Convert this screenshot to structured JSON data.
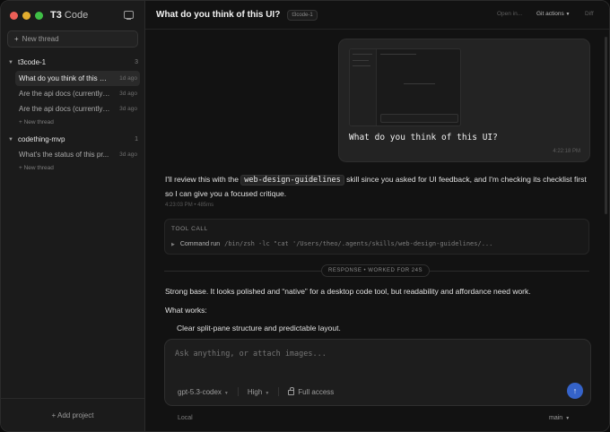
{
  "window": {
    "traffic_lights": [
      "#ec5f57",
      "#e3ad2f",
      "#3fbf46"
    ],
    "app_name_bold": "T3",
    "app_name_rest": " Code"
  },
  "sidebar": {
    "new_thread_label": "New thread",
    "projects": [
      {
        "name": "t3code-1",
        "count": "3",
        "threads": [
          {
            "title": "What do you think of this UI?",
            "ago": "1d ago",
            "active": true
          },
          {
            "title": "Are the api docs (currently ...",
            "ago": "3d ago",
            "active": false
          },
          {
            "title": "Are the api docs (currently ...",
            "ago": "3d ago",
            "active": false
          }
        ],
        "new_thread_link": "+ New thread"
      },
      {
        "name": "codething-mvp",
        "count": "1",
        "threads": [
          {
            "title": "What's the status of this pr...",
            "ago": "3d ago",
            "active": false
          }
        ],
        "new_thread_link": "+ New thread"
      }
    ],
    "add_project": "+ Add project"
  },
  "header": {
    "title": "What do you think of this UI?",
    "repo_badge": "t3code-1",
    "open_in": "Open in...",
    "git_actions": "Git actions",
    "diff": "Diff"
  },
  "conversation": {
    "user_message": {
      "text": "What do you think of this UI?",
      "time": "4:22:18 PM"
    },
    "assistant_intro": {
      "before": "I'll review this with the ",
      "chip": "web-design-guidelines",
      "after": " skill since you asked for UI feedback, and I'm checking its checklist first so I can give you a focused critique.",
      "meta": "4:23:03 PM • 485ms"
    },
    "tool_call": {
      "label": "TOOL CALL",
      "action": "Command run",
      "command": "/bin/zsh -lc \"cat '/Users/theo/.agents/skills/web-design-guidelines/..."
    },
    "divider_label": "RESPONSE • WORKED FOR 24S",
    "response_p1": "Strong base. It looks polished and “native” for a desktop code tool, but readability and affordance need work.",
    "response_p2": "What works:",
    "response_li1": "Clear split-pane structure and predictable layout."
  },
  "composer": {
    "placeholder": "Ask anything, or attach images...",
    "model": "gpt-5.3-codex",
    "effort": "High",
    "access": "Full access",
    "send_color": "#3563c9"
  },
  "footer": {
    "env": "Local",
    "branch": "main"
  },
  "icons": [
    "sidebar-toggle-icon",
    "plus-icon",
    "chevron-down-icon",
    "lock-icon",
    "arrow-up-icon"
  ]
}
